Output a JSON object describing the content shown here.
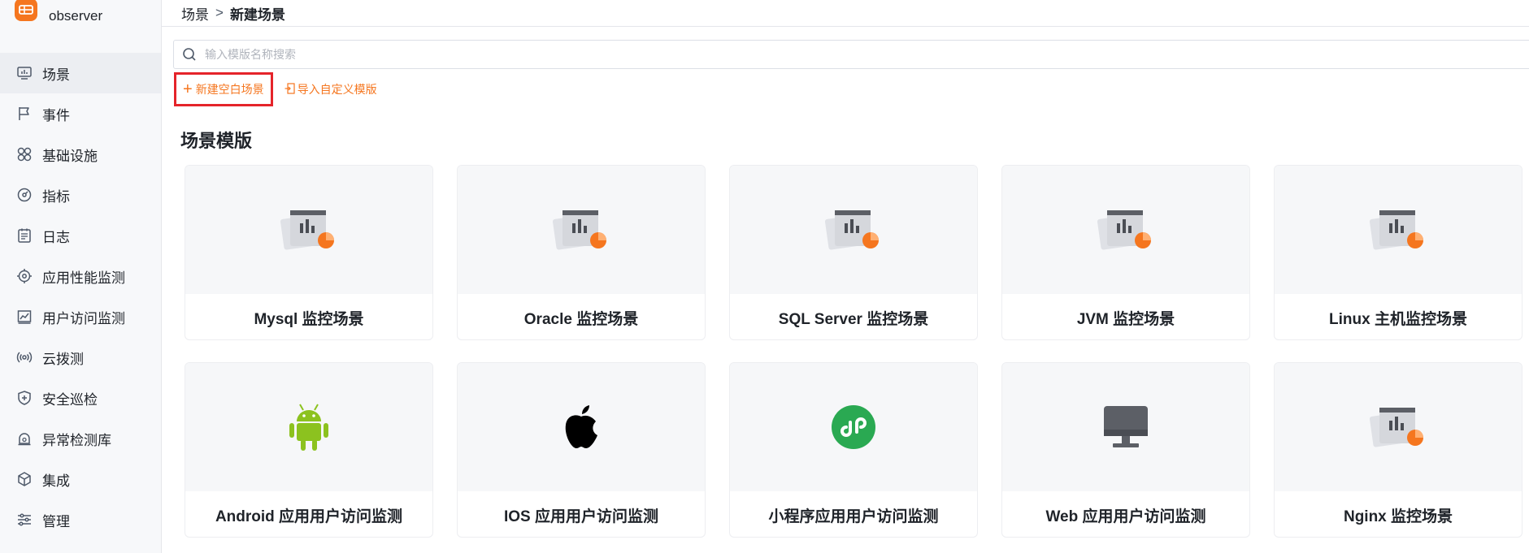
{
  "app": {
    "name": "observer"
  },
  "sidebar": {
    "items": [
      {
        "label": "场景",
        "icon": "monitor-chart-icon",
        "active": true
      },
      {
        "label": "事件",
        "icon": "flag-icon"
      },
      {
        "label": "基础设施",
        "icon": "four-circles-icon"
      },
      {
        "label": "指标",
        "icon": "gauge-icon"
      },
      {
        "label": "日志",
        "icon": "list-document-icon"
      },
      {
        "label": "应用性能监测",
        "icon": "target-icon"
      },
      {
        "label": "用户访问监测",
        "icon": "line-chart-icon"
      },
      {
        "label": "云拨测",
        "icon": "radio-waves-icon"
      },
      {
        "label": "安全巡检",
        "icon": "shield-icon"
      },
      {
        "label": "异常检测库",
        "icon": "alarm-icon"
      },
      {
        "label": "集成",
        "icon": "cube-icon"
      },
      {
        "label": "管理",
        "icon": "sliders-icon"
      }
    ]
  },
  "breadcrumb": {
    "parent": "场景",
    "separator": ">",
    "current": "新建场景"
  },
  "search": {
    "placeholder": "输入模版名称搜索",
    "value": ""
  },
  "actions": {
    "new_blank": "新建空白场景",
    "import_custom": "导入自定义模版"
  },
  "section": {
    "title": "场景模版"
  },
  "templates": [
    {
      "title": "Mysql 监控场景",
      "icon": "dashboard-chart-icon"
    },
    {
      "title": "Oracle 监控场景",
      "icon": "dashboard-chart-icon"
    },
    {
      "title": "SQL Server 监控场景",
      "icon": "dashboard-chart-icon"
    },
    {
      "title": "JVM 监控场景",
      "icon": "dashboard-chart-icon"
    },
    {
      "title": "Linux 主机监控场景",
      "icon": "dashboard-chart-icon"
    },
    {
      "title": "Android 应用用户访问监测",
      "icon": "android-icon"
    },
    {
      "title": "IOS 应用用户访问监测",
      "icon": "apple-icon"
    },
    {
      "title": "小程序应用用户访问监测",
      "icon": "mini-program-icon"
    },
    {
      "title": "Web 应用用户访问监测",
      "icon": "desktop-monitor-icon"
    },
    {
      "title": "Nginx 监控场景",
      "icon": "dashboard-chart-icon"
    }
  ],
  "colors": {
    "accent": "#f5761f",
    "highlight_border": "#e5242a",
    "android_green": "#8cc21f",
    "mini_program_green": "#2aa952"
  }
}
